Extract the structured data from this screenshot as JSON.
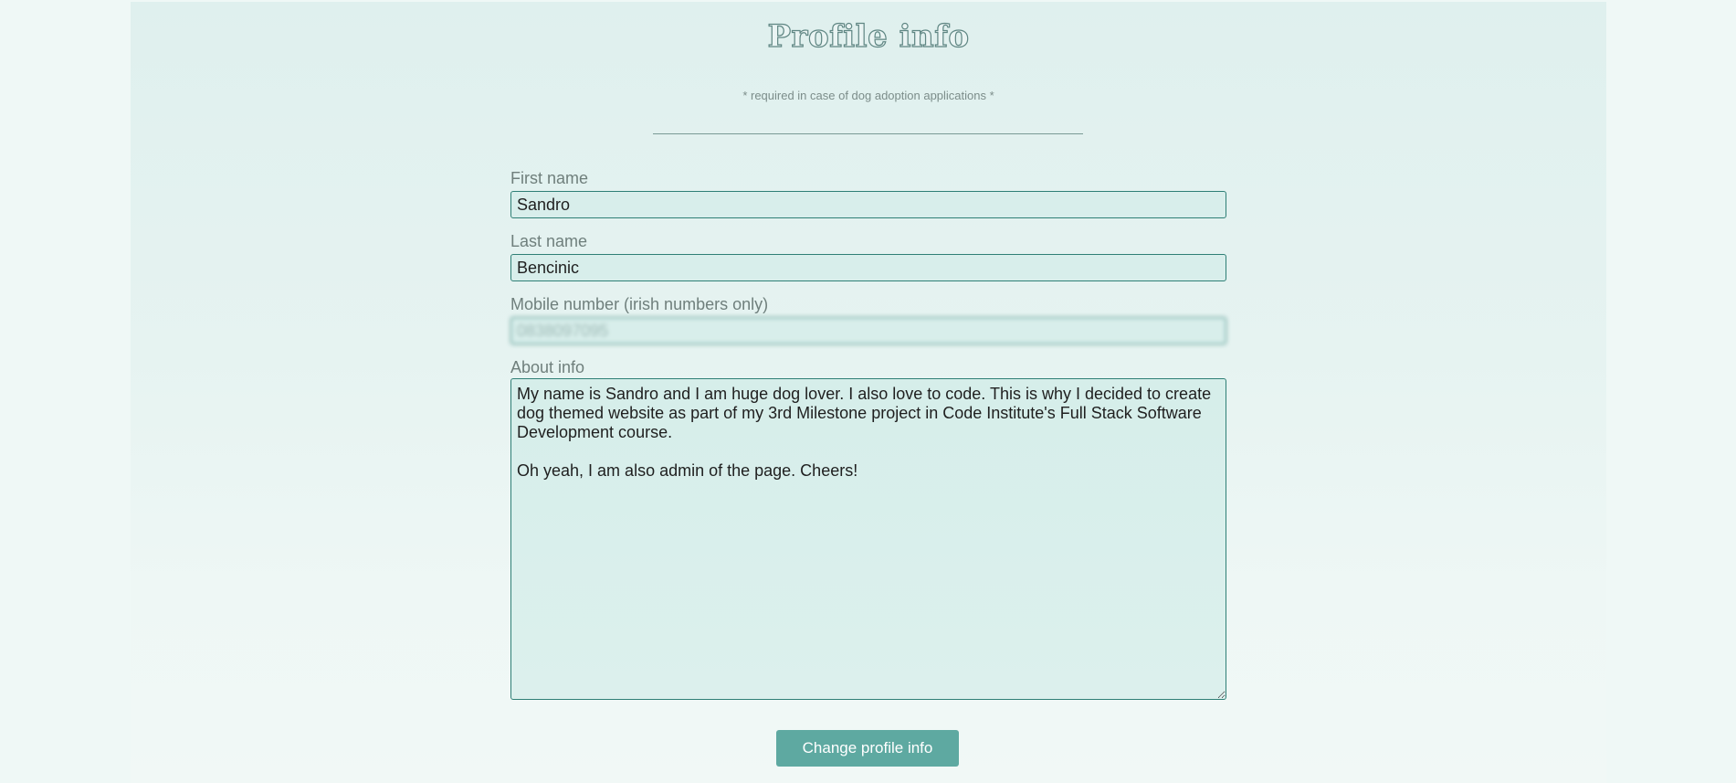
{
  "page": {
    "title": "Profile info",
    "required_note": "* required in case of dog adoption applications *"
  },
  "form": {
    "first_name": {
      "label": "First name",
      "value": "Sandro"
    },
    "last_name": {
      "label": "Last name",
      "value": "Bencinic"
    },
    "mobile": {
      "label": "Mobile number (irish numbers only)",
      "value": "0838097095"
    },
    "about": {
      "label": "About info",
      "value": "My name is Sandro and I am huge dog lover. I also love to code. This is why I decided to create dog themed website as part of my 3rd Milestone project in Code Institute's Full Stack Software Development course.\n\nOh yeah, I am also admin of the page. Cheers!"
    },
    "submit_label": "Change profile info"
  },
  "colors": {
    "accent": "#5ea9a1",
    "field_border": "#2f7f76",
    "field_bg": "#d8eeeb"
  }
}
